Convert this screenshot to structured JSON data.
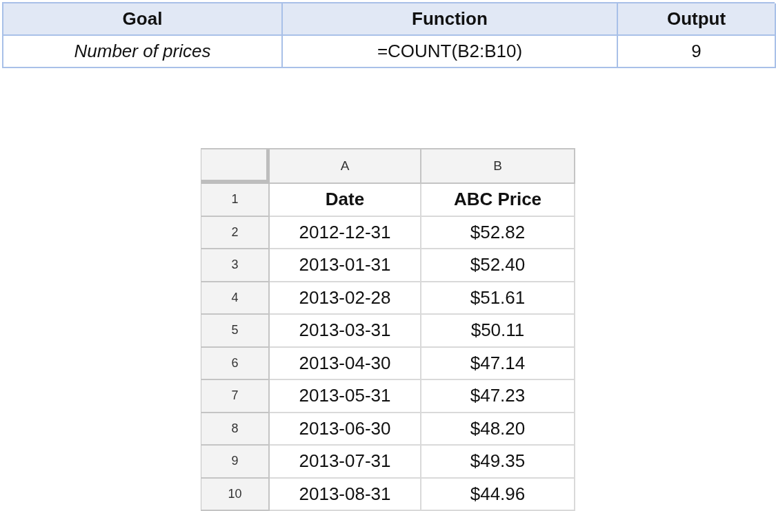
{
  "summary_table": {
    "columns": [
      "Goal",
      "Function",
      "Output"
    ],
    "rows": [
      [
        "Number of prices",
        "=COUNT(B2:B10)",
        "9"
      ]
    ]
  },
  "spreadsheet": {
    "column_headers": [
      "A",
      "B"
    ],
    "rows": [
      {
        "number": "1",
        "kind": "header",
        "cells": [
          "Date",
          "ABC Price"
        ]
      },
      {
        "number": "2",
        "kind": "data",
        "cells": [
          "2012-12-31",
          "$52.82"
        ]
      },
      {
        "number": "3",
        "kind": "data",
        "cells": [
          "2013-01-31",
          "$52.40"
        ]
      },
      {
        "number": "4",
        "kind": "data",
        "cells": [
          "2013-02-28",
          "$51.61"
        ]
      },
      {
        "number": "5",
        "kind": "data",
        "cells": [
          "2013-03-31",
          "$50.11"
        ]
      },
      {
        "number": "6",
        "kind": "data",
        "cells": [
          "2013-04-30",
          "$47.14"
        ]
      },
      {
        "number": "7",
        "kind": "data",
        "cells": [
          "2013-05-31",
          "$47.23"
        ]
      },
      {
        "number": "8",
        "kind": "data",
        "cells": [
          "2013-06-30",
          "$48.20"
        ]
      },
      {
        "number": "9",
        "kind": "data",
        "cells": [
          "2013-07-31",
          "$49.35"
        ]
      },
      {
        "number": "10",
        "kind": "data",
        "cells": [
          "2013-08-31",
          "$44.96"
        ]
      }
    ]
  }
}
